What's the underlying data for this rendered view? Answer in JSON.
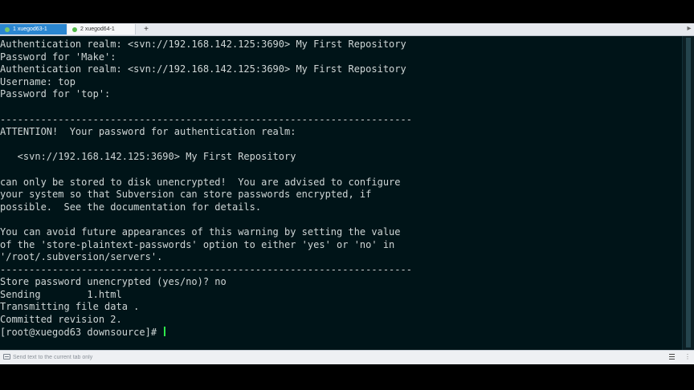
{
  "tabs": [
    {
      "label": "1 xuegod63-1"
    },
    {
      "label": "2 xuegod64-1"
    }
  ],
  "tab_add_label": "+",
  "terminal": {
    "lines": [
      "Authentication realm: <svn://192.168.142.125:3690> My First Repository",
      "Password for 'Make':",
      "Authentication realm: <svn://192.168.142.125:3690> My First Repository",
      "Username: top",
      "Password for 'top':",
      "",
      "-----------------------------------------------------------------------",
      "ATTENTION!  Your password for authentication realm:",
      "",
      "   <svn://192.168.142.125:3690> My First Repository",
      "",
      "can only be stored to disk unencrypted!  You are advised to configure",
      "your system so that Subversion can store passwords encrypted, if",
      "possible.  See the documentation for details.",
      "",
      "You can avoid future appearances of this warning by setting the value",
      "of the 'store-plaintext-passwords' option to either 'yes' or 'no' in",
      "'/root/.subversion/servers'.",
      "-----------------------------------------------------------------------",
      "Store password unencrypted (yes/no)? no",
      "Sending        1.html",
      "Transmitting file data .",
      "Committed revision 2."
    ],
    "prompt": "[root@xuegod63 downsource]# "
  },
  "input_bar": {
    "placeholder": "Send text to the current tab only"
  },
  "colors": {
    "terminal_bg": "#001418",
    "terminal_fg": "#cfd6d6",
    "cursor": "#2ee84b",
    "active_tab": "#2b86d0"
  }
}
